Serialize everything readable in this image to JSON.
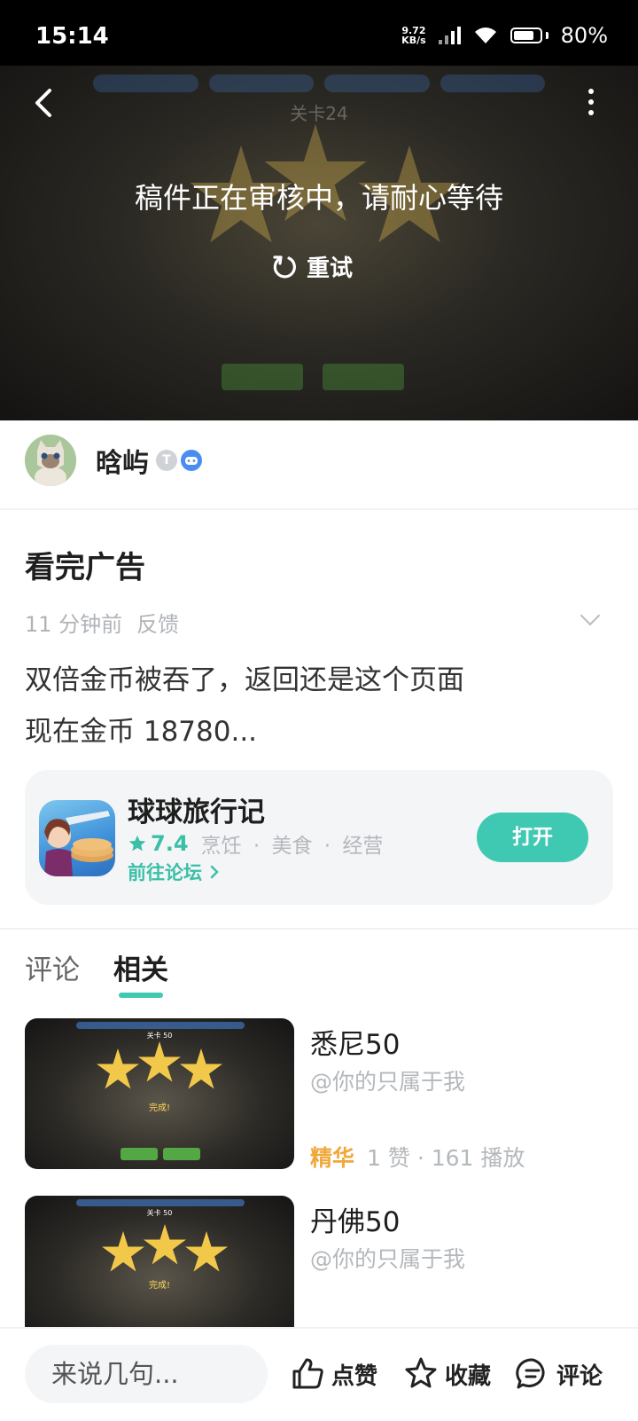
{
  "status_bar": {
    "time": "15:14",
    "net_speed_value": "9.72",
    "net_speed_unit": "KB/s",
    "battery_percent": "80%",
    "battery_level": 0.8
  },
  "video": {
    "review_message": "稿件正在审核中，请耐心等待",
    "retry_label": "重试"
  },
  "author": {
    "name": "晗屿",
    "level_badge": "T"
  },
  "post": {
    "title": "看完广告",
    "time_ago": "11 分钟前",
    "feedback_label": "反馈",
    "body": "双倍金币被吞了，返回还是这个页面\n现在金币 18780..."
  },
  "app_card": {
    "name": "球球旅行记",
    "rating": "7.4",
    "tags": [
      "烹饪",
      "美食",
      "经营"
    ],
    "forum_link": "前往论坛",
    "open_button": "打开",
    "accent_color": "#3fc8b2"
  },
  "tabs": [
    {
      "label": "评论",
      "active": false
    },
    {
      "label": "相关",
      "active": true
    }
  ],
  "related": [
    {
      "title": "悉尼50",
      "author": "@你的只属于我",
      "essence": "精华",
      "stats": "1 赞 · 161 播放",
      "thumb_level": "关卡 50",
      "thumb_done": "完成!"
    },
    {
      "title": "丹佛50",
      "author": "@你的只属于我",
      "essence": "",
      "stats": "",
      "thumb_level": "关卡 50",
      "thumb_done": "完成!"
    }
  ],
  "bottom_bar": {
    "comment_placeholder": "来说几句...",
    "like_label": "点赞",
    "favorite_label": "收藏",
    "comment_label": "评论"
  }
}
